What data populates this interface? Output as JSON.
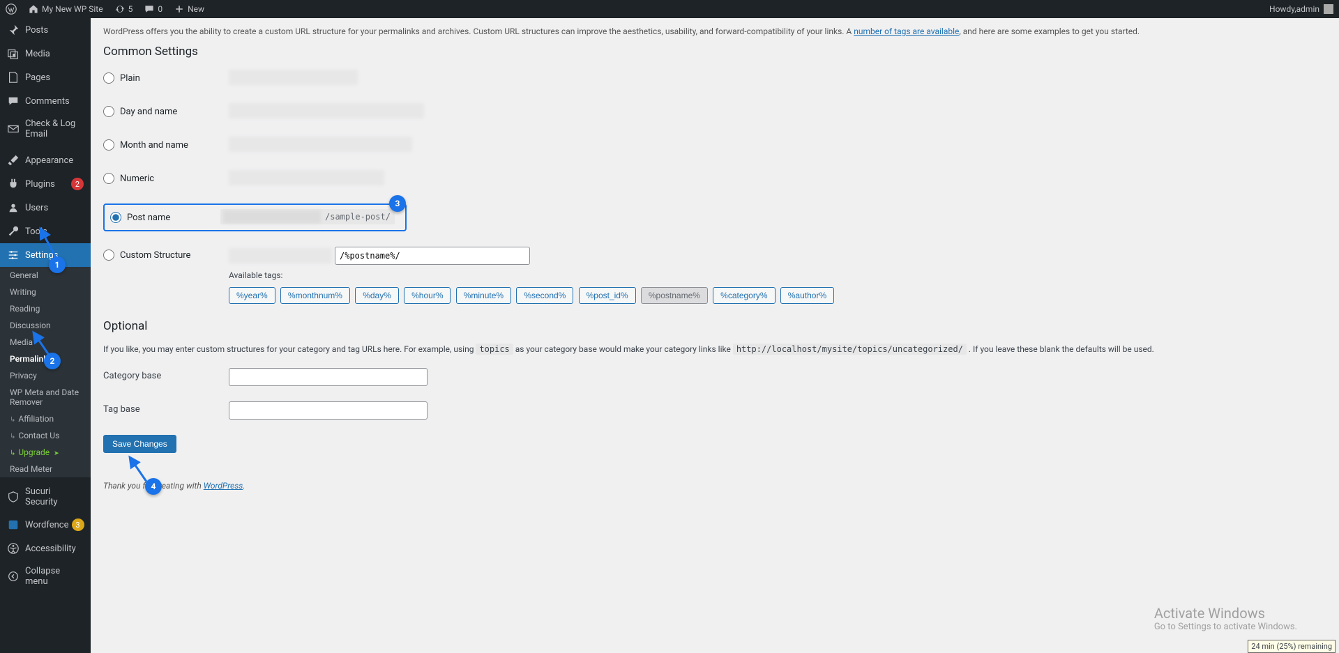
{
  "adminbar": {
    "site_name": "My New WP Site",
    "updates_count": "5",
    "comments_count": "0",
    "new_label": "New",
    "howdy_prefix": "Howdy, ",
    "user": "admin"
  },
  "sidebar": {
    "posts": "Posts",
    "media": "Media",
    "pages": "Pages",
    "comments": "Comments",
    "check_log": "Check & Log Email",
    "appearance": "Appearance",
    "plugins": "Plugins",
    "plugins_badge": "2",
    "users": "Users",
    "tools": "Tools",
    "settings": "Settings",
    "sucuri": "Sucuri Security",
    "wordfence": "Wordfence",
    "wordfence_badge": "3",
    "accessibility": "Accessibility",
    "collapse": "Collapse menu",
    "sub": {
      "general": "General",
      "writing": "Writing",
      "reading": "Reading",
      "discussion": "Discussion",
      "media": "Media",
      "permalinks": "Permalinks",
      "privacy": "Privacy",
      "wpmeta": "WP Meta and Date Remover",
      "affiliation": "Affiliation",
      "contact": "Contact Us",
      "upgrade": "Upgrade",
      "readmeter": "Read Meter"
    }
  },
  "content": {
    "intro_pre": "WordPress offers you the ability to create a custom URL structure for your permalinks and archives. Custom URL structures can improve the aesthetics, usability, and forward-compatibility of your links. A ",
    "intro_link": "number of tags are available",
    "intro_post": ", and here are some examples to get you started.",
    "common_settings": "Common Settings",
    "opt_plain": "Plain",
    "opt_dayname": "Day and name",
    "opt_monthname": "Month and name",
    "opt_numeric": "Numeric",
    "opt_postname": "Post name",
    "postname_example_suffix": "/sample-post/",
    "opt_custom": "Custom Structure",
    "custom_value": "/%postname%/",
    "available_tags": "Available tags:",
    "tags": [
      "%year%",
      "%monthnum%",
      "%day%",
      "%hour%",
      "%minute%",
      "%second%",
      "%post_id%",
      "%postname%",
      "%category%",
      "%author%"
    ],
    "optional_heading": "Optional",
    "optional_text_pre": "If you like, you may enter custom structures for your category and tag URLs here. For example, using ",
    "optional_code1": "topics",
    "optional_text_mid": " as your category base would make your category links like ",
    "optional_code2": "http://localhost/mysite/topics/uncategorized/",
    "optional_text_post": " . If you leave these blank the defaults will be used.",
    "category_base": "Category base",
    "tag_base": "Tag base",
    "save": "Save Changes",
    "thanks_pre": "Thank you for creating with ",
    "thanks_link": "WordPress",
    "thanks_post": "."
  },
  "watermark": {
    "l1": "Activate Windows",
    "l2": "Go to Settings to activate Windows."
  },
  "battery": "24 min (25%) remaining",
  "annotations": {
    "a1": "1",
    "a2": "2",
    "a3": "3",
    "a4": "4"
  }
}
